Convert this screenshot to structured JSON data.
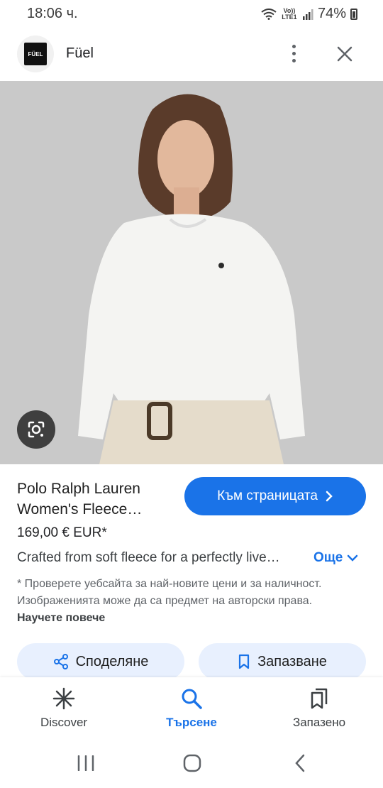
{
  "status_bar": {
    "time": "18:06 ч.",
    "network_label": "Vo)) LTE1",
    "battery": "74%"
  },
  "header": {
    "logo_text": "FÜEL",
    "site_name": "Füel"
  },
  "product": {
    "title": "Polo Ralph Lauren\nWomen's Fleece…",
    "visit_button": "Към страницата",
    "price": "169,00 € EUR*",
    "description": "Crafted from soft fleece for a perfectly live…",
    "more_label": "Още",
    "disclaimer": "* Проверете уебсайта за най-новите цени и за наличност. Изображенията може да са предмет на авторски права.",
    "learn_more": "Научете повече"
  },
  "actions": {
    "share_label": "Споделяне",
    "save_label": "Запазване"
  },
  "bottom_nav": {
    "items": [
      {
        "label": "Discover",
        "icon": "asterisk-icon"
      },
      {
        "label": "Търсене",
        "icon": "search-icon"
      },
      {
        "label": "Запазено",
        "icon": "bookmarks-icon"
      }
    ],
    "active_index": 1
  },
  "colors": {
    "accent": "#1a73e8",
    "chip_bg": "#e8f0fe",
    "image_bg": "#c8c8c8"
  }
}
